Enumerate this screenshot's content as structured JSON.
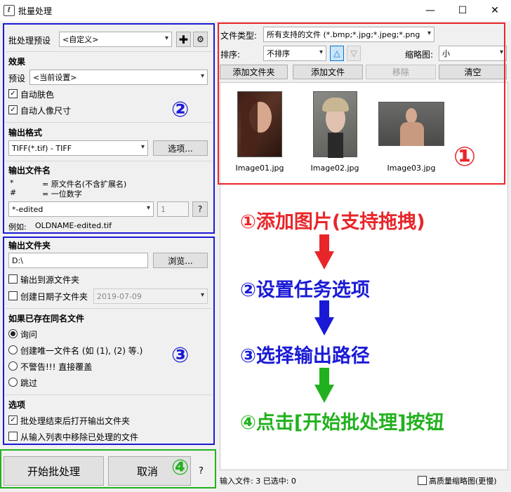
{
  "window": {
    "title": "批量处理",
    "minimize": "—",
    "maximize": "☐",
    "close": "✕"
  },
  "preset": {
    "label": "批处理预设",
    "value": "<自定义>"
  },
  "effects": {
    "title": "效果",
    "preset_label": "预设",
    "preset_value": "<当前设置>",
    "auto_skin": "自动肤色",
    "auto_portrait": "自动人像尺寸"
  },
  "output_format": {
    "title": "输出格式",
    "value": "TIFF(*.tif) - TIFF",
    "options_button": "选项..."
  },
  "output_filename": {
    "title": "输出文件名",
    "hint1_key": "*",
    "hint1_val": "= 原文件名(不含扩展名)",
    "hint2_key": "#",
    "hint2_val": "= 一位数字",
    "pattern": "*-edited",
    "digit": "1",
    "help": "?",
    "example_label": "例如:",
    "example_value": "OLDNAME-edited.tif"
  },
  "output_folder": {
    "title": "输出文件夹",
    "path": "D:\\",
    "browse": "浏览...",
    "to_source": "输出到源文件夹",
    "date_subfolder": "创建日期子文件夹",
    "date_value": "2019-07-09"
  },
  "exists": {
    "title": "如果已存在同名文件",
    "ask": "询问",
    "unique": "创建唯一文件名 (如 (1), (2) 等.)",
    "overwrite": "不警告!!! 直接覆盖",
    "skip": "跳过"
  },
  "options": {
    "title": "选项",
    "open_folder": "批处理结束后打开输出文件夹",
    "remove_processed": "从输入列表中移除已处理的文件"
  },
  "actions": {
    "start": "开始批处理",
    "cancel": "取消",
    "help": "?"
  },
  "filelist": {
    "type_label": "文件类型:",
    "type_value": "所有支持的文件 (*.bmp;*.jpg;*.jpeg;*.png",
    "sort_label": "排序:",
    "sort_value": "不排序",
    "asc": "△",
    "desc": "▽",
    "thumb_label": "缩略图:",
    "thumb_value": "小",
    "add_folder": "添加文件夹",
    "add_file": "添加文件",
    "remove": "移除",
    "clear": "清空",
    "items": [
      {
        "name": "Image01.jpg"
      },
      {
        "name": "Image02.jpg"
      },
      {
        "name": "Image03.jpg"
      }
    ]
  },
  "status": {
    "text": "输入文件: 3  已选中: 0",
    "hq_thumbs": "高质量缩略图(更慢)"
  },
  "annotations": {
    "n1": "①",
    "n2": "②",
    "n3": "③",
    "n4": "④",
    "step1": "①添加图片(支持拖拽)",
    "step2": "②设置任务选项",
    "step3": "③选择输出路径",
    "step4": "④点击[开始批处理]按钮"
  },
  "colors": {
    "red": "#e8262a",
    "blue": "#1a1ad6",
    "green": "#22b11e",
    "accent": "#0078d7"
  }
}
